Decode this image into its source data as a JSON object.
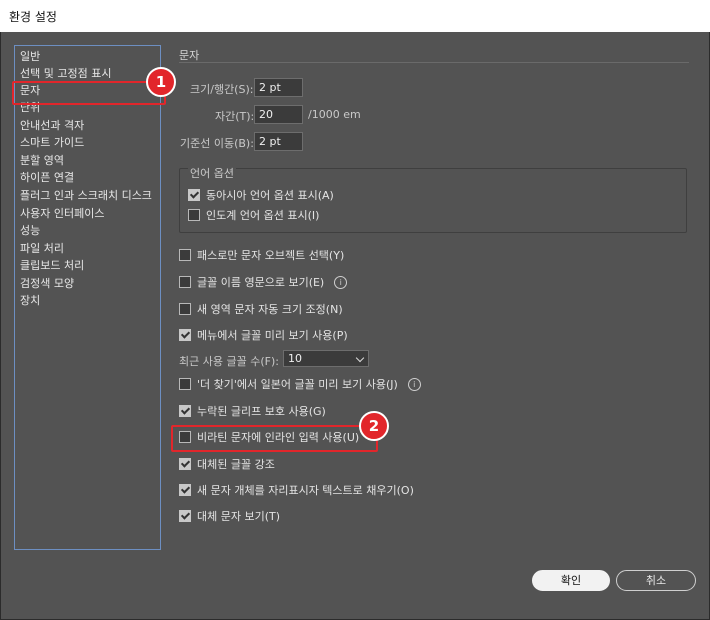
{
  "window": {
    "title": "환경 설정"
  },
  "sidebar": {
    "items": [
      {
        "label": "일반"
      },
      {
        "label": "선택 및 고정점 표시"
      },
      {
        "label": "문자"
      },
      {
        "label": "단위"
      },
      {
        "label": "안내선과 격자"
      },
      {
        "label": "스마트 가이드"
      },
      {
        "label": "분할 영역"
      },
      {
        "label": "하이픈 연결"
      },
      {
        "label": "플러그 인과 스크래치 디스크"
      },
      {
        "label": "사용자 인터페이스"
      },
      {
        "label": "성능"
      },
      {
        "label": "파일 처리"
      },
      {
        "label": "클립보드 처리"
      },
      {
        "label": "검정색 모양"
      },
      {
        "label": "장치"
      }
    ],
    "selected_index": 2
  },
  "annotations": {
    "badge1": "1",
    "badge2": "2",
    "accent": "#e2262b"
  },
  "type": {
    "section_title": "문자",
    "size_leading": {
      "label": "크기/행간(S):",
      "value": "2 pt"
    },
    "tracking": {
      "label": "자간(T):",
      "value": "20",
      "unit": "/1000 em"
    },
    "baseline_shift": {
      "label": "기준선 이동(B):",
      "value": "2 pt"
    },
    "language_group": {
      "title": "언어 옵션",
      "options": [
        {
          "label": "동아시아 언어 옵션 표시(A)",
          "checked": true
        },
        {
          "label": "인도계 언어 옵션 표시(I)",
          "checked": false
        }
      ]
    },
    "options": [
      {
        "label": "패스로만 문자 오브젝트 선택(Y)",
        "checked": false,
        "info": false
      },
      {
        "label": "글꼴 이름 영문으로 보기(E)",
        "checked": false,
        "info": true
      },
      {
        "label": "새 영역 문자 자동 크기 조정(N)",
        "checked": false,
        "info": false
      },
      {
        "label": "메뉴에서 글꼴 미리 보기 사용(P)",
        "checked": true,
        "info": false
      }
    ],
    "recent_fonts": {
      "label": "최근 사용 글꼴 수(F):",
      "value": "10"
    },
    "options2": [
      {
        "label": "'더 찾기'에서 일본어 글꼴 미리 보기 사용(J)",
        "checked": false,
        "info": true
      },
      {
        "label": "누락된 글리프 보호 사용(G)",
        "checked": true,
        "info": false
      },
      {
        "label": "비라틴 문자에 인라인 입력 사용(U)",
        "checked": false,
        "info": false
      },
      {
        "label": "대체된 글꼴 강조",
        "checked": true,
        "info": false
      },
      {
        "label": "새 문자 개체를 자리표시자 텍스트로 채우기(O)",
        "checked": true,
        "info": false
      },
      {
        "label": "대체 문자 보기(T)",
        "checked": true,
        "info": false
      }
    ],
    "info_symbol": "i"
  },
  "buttons": {
    "ok": "확인",
    "cancel": "취소"
  }
}
